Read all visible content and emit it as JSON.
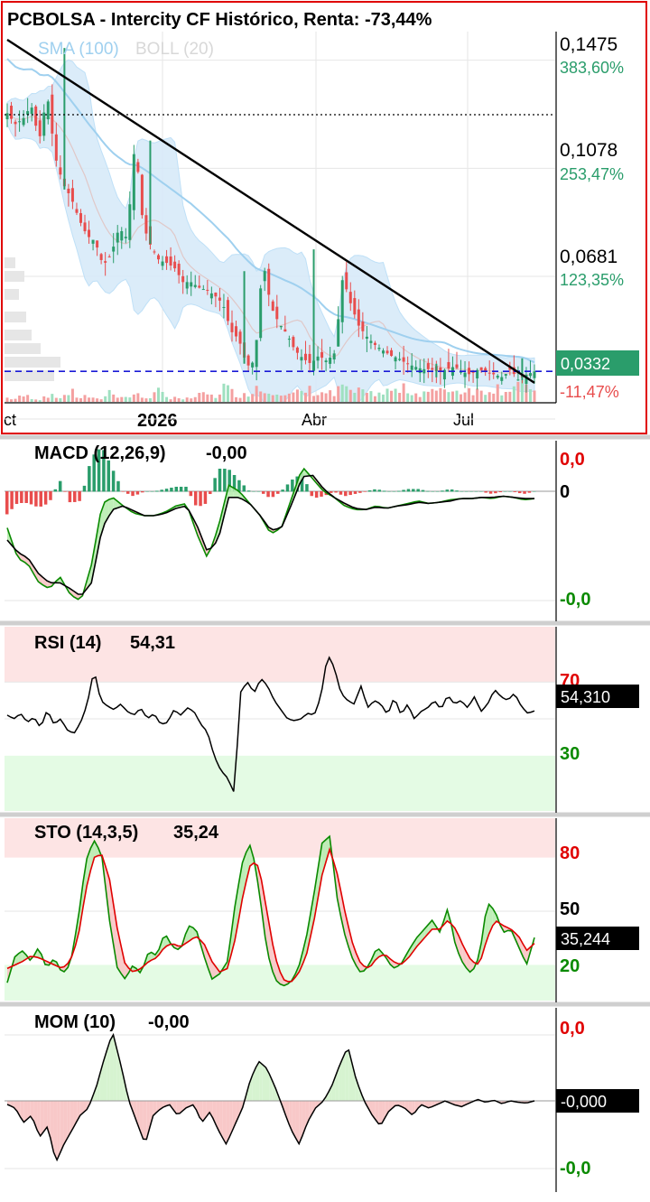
{
  "header": {
    "title": "PCBOLSA - Intercity CF Histórico, Renta: -73,44%",
    "legend_sma": "SMA (100)",
    "legend_boll": "BOLL (20)"
  },
  "price_axis": [
    {
      "price": "0,1475",
      "pct": "383,60%"
    },
    {
      "price": "0,1078",
      "pct": "253,47%"
    },
    {
      "price": "0,0681",
      "pct": "123,35%"
    }
  ],
  "last_price": {
    "value": "0,0332",
    "pct": "-11,47%"
  },
  "date_axis": {
    "labels": [
      "ct",
      "Abr",
      "Jul"
    ],
    "year_label": "2026"
  },
  "macd": {
    "title": "MACD (12,26,9)",
    "value": "-0,00",
    "axis_top": "0,0",
    "axis_zero": "0",
    "axis_bottom": "-0,0"
  },
  "rsi": {
    "title": "RSI (14)",
    "value": "54,31",
    "level_high": "70",
    "level_low": "30",
    "tag": "54,310"
  },
  "sto": {
    "title": "STO (14,3,5)",
    "value": "35,24",
    "level_high": "80",
    "level_mid": "50",
    "level_low": "20",
    "tag": "35,244"
  },
  "mom": {
    "title": "MOM (10)",
    "value": "-0,00",
    "axis_top": "0,0",
    "axis_bottom": "-0,0",
    "tag": "-0,000"
  },
  "colors": {
    "up": "#2a9d6b",
    "down": "#e84d4d",
    "sma": "#9fd0ef",
    "band": "#d5e9f8",
    "frame": "#e00000",
    "last_tag": "#2a9d6b",
    "trend": "#000000"
  },
  "chart_data": [
    {
      "type": "candlestick",
      "title": "PCBOLSA - Intercity CF Histórico, Renta: -73,44%",
      "y_ticks": [
        0.1475,
        0.1078,
        0.0681
      ],
      "ylim": [
        0.022,
        0.158
      ],
      "last_value": 0.0332,
      "overlays": [
        "SMA (100)",
        "BOLL (20)"
      ],
      "close_path": [
        0.128,
        0.124,
        0.126,
        0.131,
        0.118,
        0.135,
        0.112,
        0.102,
        0.097,
        0.089,
        0.083,
        0.081,
        0.072,
        0.076,
        0.086,
        0.082,
        0.118,
        0.087,
        0.079,
        0.074,
        0.073,
        0.071,
        0.066,
        0.066,
        0.064,
        0.063,
        0.061,
        0.058,
        0.048,
        0.045,
        0.035,
        0.037,
        0.074,
        0.057,
        0.051,
        0.047,
        0.041,
        0.038,
        0.036,
        0.039,
        0.037,
        0.04,
        0.068,
        0.058,
        0.05,
        0.046,
        0.043,
        0.041,
        0.039,
        0.038,
        0.036,
        0.035,
        0.034,
        0.034,
        0.033,
        0.034,
        0.035,
        0.033,
        0.032,
        0.034,
        0.033,
        0.032,
        0.031,
        0.034,
        0.03,
        0.032,
        0.0332
      ],
      "volume_path": [
        0.2,
        0.15,
        0.3,
        0.25,
        0.1,
        0.4,
        0.2,
        0.3,
        0.5,
        0.2,
        0.3,
        0.1,
        0.2,
        0.6,
        0.3,
        0.2,
        0.4,
        0.2,
        0.3,
        0.5,
        0.2,
        0.3,
        0.1,
        0.2,
        0.3,
        0.4,
        0.2,
        0.8,
        0.5,
        0.4,
        0.3,
        0.9,
        0.5,
        0.7,
        0.6,
        0.3,
        0.4,
        0.5,
        0.6,
        0.4,
        0.5,
        0.3,
        0.9,
        0.4,
        0.6,
        0.3,
        0.5,
        0.4,
        0.6,
        0.5,
        0.7,
        0.4,
        0.5,
        0.6,
        0.4,
        0.8,
        0.5,
        0.6,
        0.7,
        0.5,
        0.6,
        0.8,
        0.6,
        0.7,
        0.9,
        0.6,
        0.8
      ],
      "trendline": [
        [
          0,
          0.155
        ],
        [
          66,
          0.029
        ]
      ]
    },
    {
      "type": "line",
      "title": "MACD (12,26,9)",
      "value": -0.0,
      "ylim": [
        -1,
        1
      ],
      "y_ticks": [
        "0,0",
        "0",
        "-0,0"
      ],
      "macd_path": [
        -0.3,
        -0.55,
        -0.6,
        -0.75,
        -0.8,
        -0.7,
        -0.85,
        -0.9,
        -0.6,
        -0.1,
        -0.05,
        -0.12,
        -0.18,
        -0.2,
        -0.2,
        -0.17,
        -0.12,
        -0.1,
        -0.35,
        -0.55,
        -0.3,
        0.05,
        0.0,
        -0.1,
        -0.2,
        -0.35,
        -0.3,
        -0.05,
        0.2,
        0.1,
        0.0,
        -0.05,
        -0.12,
        -0.15,
        -0.15,
        -0.12,
        -0.14,
        -0.12,
        -0.1,
        -0.08,
        -0.1,
        -0.09,
        -0.07,
        -0.06,
        -0.06,
        -0.05,
        -0.06,
        -0.04,
        -0.05,
        -0.07,
        -0.06
      ],
      "signal_path": [
        -0.4,
        -0.5,
        -0.55,
        -0.68,
        -0.75,
        -0.75,
        -0.8,
        -0.86,
        -0.75,
        -0.3,
        -0.15,
        -0.12,
        -0.16,
        -0.2,
        -0.2,
        -0.18,
        -0.14,
        -0.12,
        -0.28,
        -0.5,
        -0.4,
        -0.05,
        -0.05,
        -0.1,
        -0.2,
        -0.32,
        -0.3,
        -0.1,
        0.12,
        0.13,
        0.02,
        -0.05,
        -0.1,
        -0.14,
        -0.15,
        -0.13,
        -0.14,
        -0.12,
        -0.11,
        -0.09,
        -0.1,
        -0.09,
        -0.08,
        -0.06,
        -0.06,
        -0.05,
        -0.05,
        -0.04,
        -0.05,
        -0.06,
        -0.06
      ],
      "histogram_path": [
        -0.1,
        -0.05,
        -0.05,
        -0.07,
        -0.05,
        0.05,
        -0.05,
        -0.04,
        0.15,
        0.2,
        0.1,
        0.0,
        -0.02,
        0.0,
        0.0,
        0.01,
        0.02,
        0.02,
        -0.07,
        -0.05,
        0.1,
        0.1,
        0.05,
        0.0,
        0.0,
        -0.03,
        0.0,
        0.05,
        0.08,
        -0.03,
        -0.02,
        0.0,
        -0.02,
        -0.01,
        0.0,
        0.01,
        0.0,
        0.0,
        0.01,
        0.01,
        0.0,
        0.0,
        0.01,
        0.0,
        0.0,
        0.0,
        -0.01,
        0.0,
        0.0,
        -0.01,
        0.0
      ]
    },
    {
      "type": "line",
      "title": "RSI (14)",
      "value": 54.31,
      "ylim": [
        0,
        100
      ],
      "levels": [
        70,
        30
      ],
      "series_path": [
        52,
        50,
        53,
        48,
        51,
        45,
        55,
        47,
        50,
        44,
        42,
        48,
        58,
        77,
        60,
        57,
        55,
        58,
        54,
        52,
        56,
        50,
        53,
        47,
        48,
        55,
        52,
        56,
        54,
        47,
        43,
        30,
        22,
        18,
        10,
        65,
        70,
        64,
        72,
        68,
        60,
        55,
        50,
        49,
        50,
        53,
        52,
        62,
        85,
        78,
        64,
        60,
        58,
        68,
        56,
        60,
        58,
        52,
        62,
        52,
        58,
        50,
        54,
        56,
        60,
        55,
        63,
        58,
        60,
        56,
        62,
        54,
        58,
        66,
        62,
        60,
        64,
        57,
        53,
        54.31
      ],
      "tag": "54,310"
    },
    {
      "type": "line",
      "title": "STO (14,3,5)",
      "value": 35.24,
      "ylim": [
        0,
        100
      ],
      "levels": [
        80,
        50,
        20
      ],
      "k_path": [
        10,
        25,
        28,
        22,
        30,
        18,
        24,
        15,
        20,
        45,
        78,
        90,
        82,
        45,
        18,
        12,
        20,
        15,
        28,
        25,
        38,
        30,
        28,
        42,
        40,
        25,
        12,
        15,
        22,
        55,
        80,
        88,
        62,
        28,
        12,
        8,
        10,
        18,
        35,
        60,
        88,
        92,
        55,
        35,
        22,
        15,
        20,
        30,
        25,
        18,
        20,
        28,
        35,
        40,
        45,
        38,
        52,
        30,
        20,
        15,
        25,
        55,
        50,
        38,
        40,
        30,
        20,
        35.24
      ],
      "d_path": [
        18,
        20,
        22,
        25,
        24,
        22,
        20,
        18,
        22,
        35,
        62,
        80,
        82,
        68,
        40,
        20,
        16,
        18,
        22,
        24,
        30,
        32,
        30,
        33,
        36,
        32,
        22,
        16,
        18,
        35,
        60,
        78,
        75,
        50,
        25,
        12,
        10,
        15,
        25,
        45,
        70,
        85,
        70,
        48,
        30,
        20,
        18,
        24,
        26,
        22,
        20,
        24,
        30,
        35,
        40,
        40,
        45,
        40,
        30,
        22,
        20,
        35,
        45,
        42,
        40,
        36,
        28,
        32
      ]
    },
    {
      "type": "line",
      "title": "MOM (10)",
      "value": -0.0,
      "ylim": [
        -1,
        1
      ],
      "y_ticks": [
        "0,0",
        "-0,0"
      ],
      "series_path": [
        -0.05,
        -0.1,
        -0.3,
        -0.2,
        -0.5,
        -0.35,
        -0.85,
        -0.6,
        -0.4,
        -0.2,
        -0.1,
        0.2,
        0.6,
        0.95,
        0.5,
        0.0,
        -0.3,
        -0.6,
        -0.2,
        -0.1,
        -0.05,
        -0.2,
        -0.1,
        -0.05,
        -0.3,
        -0.15,
        -0.4,
        -0.6,
        -0.35,
        -0.1,
        0.3,
        0.55,
        0.45,
        0.2,
        -0.1,
        -0.4,
        -0.6,
        -0.3,
        -0.1,
        0.0,
        0.2,
        0.5,
        0.75,
        0.3,
        0.0,
        -0.2,
        -0.35,
        -0.15,
        -0.05,
        -0.1,
        -0.2,
        -0.05,
        -0.1,
        -0.05,
        0.0,
        -0.05,
        -0.08,
        -0.03,
        0.02,
        -0.02,
        0.01,
        -0.04,
        0.0,
        -0.02,
        -0.03,
        0.0
      ]
    }
  ]
}
